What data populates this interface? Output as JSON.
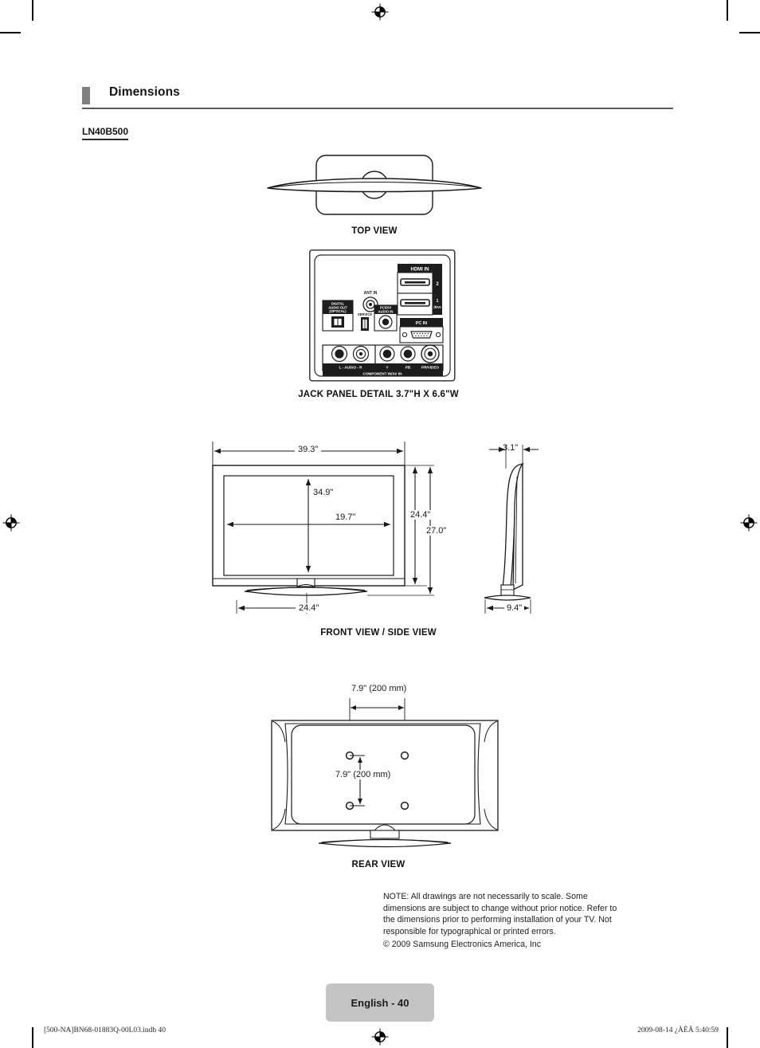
{
  "header": {
    "title": "Dimensions",
    "accent_color": "#808080",
    "rule_color": "#5b5b5b"
  },
  "model": {
    "name": "LN40B500"
  },
  "views": [
    {
      "id": "top",
      "caption": "TOP VIEW"
    },
    {
      "id": "jack",
      "caption": "JACK PANEL DETAIL 3.7\"H X 6.6\"W"
    },
    {
      "id": "front",
      "caption": "FRONT VIEW / SIDE VIEW"
    },
    {
      "id": "rear",
      "caption": "REAR VIEW"
    }
  ],
  "captions": {
    "top_view": "TOP VIEW",
    "jack_panel": "JACK PANEL DETAIL 3.7\"H X 6.6\"W",
    "front_side_view": "FRONT VIEW / SIDE VIEW",
    "rear_view": "REAR VIEW"
  },
  "jack_panel": {
    "labels": {
      "hdmi_in": "HDMI IN",
      "hdmi_2": "2",
      "hdmi_1": "1",
      "hdmi_1_sub": "/DVI",
      "ant_in": "ANT IN",
      "digital_audio_out": "DIGITAL AUDIO OUT (OPTICAL)",
      "service": "SERVICE",
      "pc_dvi_audio_in": "PC/DVI AUDIO IN",
      "pc_in": "PC IN",
      "audio": "AUDIO",
      "audio_l": "L",
      "audio_r": "R",
      "video": "VIDEO",
      "component_av": "COMPONENT IN/AV IN",
      "comp_y": "Y",
      "comp_pb": "PB",
      "comp_pr": "PR"
    }
  },
  "front_view": {
    "overall_width": "39.3\"",
    "screen_width": "34.9\"",
    "screen_height": "19.7\"",
    "panel_height": "24.4\"",
    "total_height": "27.0\"",
    "stand_width": "24.4\""
  },
  "side_view": {
    "panel_depth": "3.1\"",
    "stand_depth": "9.4\""
  },
  "rear_view": {
    "vesa_horizontal": "7.9\" (200 mm)",
    "vesa_vertical": "7.9\" (200 mm)"
  },
  "note": {
    "line1": "NOTE: All drawings are not necessarily to scale. Some",
    "line2": "dimensions are subject to change without prior notice. Refer to",
    "line3": "the dimensions prior to performing installation of your TV. Not",
    "line4": "responsible for typographical or printed errors.",
    "copyright": "© 2009 Samsung Electronics America, Inc"
  },
  "page_badge": {
    "label": "English - 40",
    "background": "#c4c4c4"
  },
  "print_footer": {
    "left": "[500-NA]BN68-01883Q-00L03.indb   40",
    "right": "2009-08-14   ¿ÀÈÄ 5:40:59"
  }
}
